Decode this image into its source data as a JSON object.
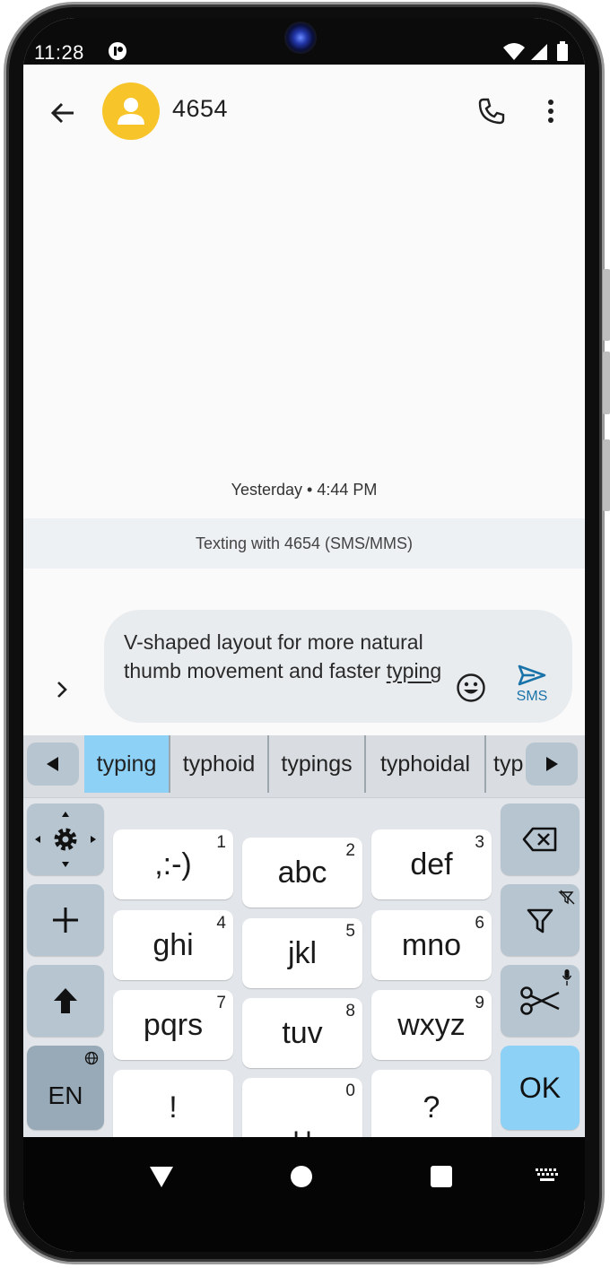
{
  "status_bar": {
    "time": "11:28"
  },
  "conversation": {
    "title": "4654"
  },
  "thread": {
    "timestamp": "Yesterday • 4:44 PM",
    "banner": "Texting with 4654 (SMS/MMS)"
  },
  "composer": {
    "text_before": "V-shaped layout for more natural thumb movement and faster ",
    "text_underlined": "typing",
    "send_label": "SMS"
  },
  "keyboard": {
    "suggestions": [
      "typing",
      "typhoid",
      "typings",
      "typhoidal",
      "typ"
    ],
    "active_suggestion": "typing",
    "keys": [
      {
        "label": ",:-)",
        "num": "1"
      },
      {
        "label": "abc",
        "num": "2"
      },
      {
        "label": "def",
        "num": "3"
      },
      {
        "label": "ghi",
        "num": "4"
      },
      {
        "label": "jkl",
        "num": "5"
      },
      {
        "label": "mno",
        "num": "6"
      },
      {
        "label": "pqrs",
        "num": "7"
      },
      {
        "label": "tuv",
        "num": "8"
      },
      {
        "label": "wxyz",
        "num": "9"
      },
      {
        "label": "!",
        "num": ""
      },
      {
        "label": "␣",
        "num": "0"
      },
      {
        "label": "?",
        "num": ""
      }
    ],
    "language": "EN",
    "ok_label": "OK"
  },
  "colors": {
    "avatar": "#f7c42a",
    "accent": "#8dd1f7",
    "function_key": "#b7c5d1",
    "send": "#1a73a8"
  }
}
